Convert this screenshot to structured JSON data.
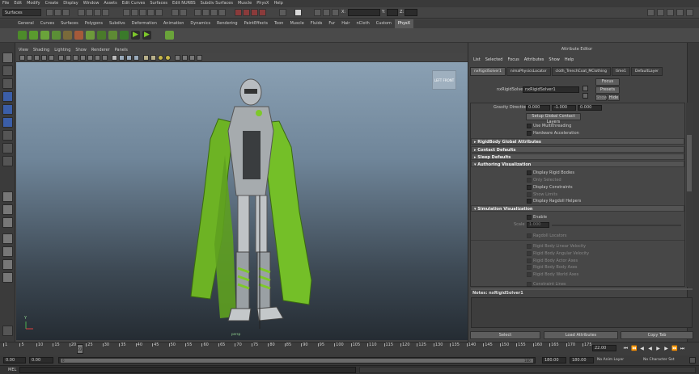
{
  "menubar": {
    "items": [
      "File",
      "Edit",
      "Modify",
      "Create",
      "Display",
      "Window",
      "Assets",
      "Edit Curves",
      "Surfaces",
      "Edit NURBS",
      "Subdiv Surfaces",
      "Muscle",
      "PhysX",
      "Help"
    ]
  },
  "statusline": {
    "menu_set": "Surfaces",
    "field_x_label": "X:",
    "field_y_label": "Y:",
    "field_z_label": "Z:"
  },
  "shelf_tabs": {
    "items": [
      "General",
      "Curves",
      "Surfaces",
      "Polygons",
      "Subdivs",
      "Deformation",
      "Animation",
      "Dynamics",
      "Rendering",
      "PaintEffects",
      "Toon",
      "Muscle",
      "Fluids",
      "Fur",
      "Hair",
      "nCloth",
      "Custom",
      "PhysX"
    ],
    "active": "PhysX"
  },
  "viewport": {
    "menu": [
      "View",
      "Shading",
      "Lighting",
      "Show",
      "Renderer",
      "Panels"
    ],
    "viewcube": {
      "left": "LEFT",
      "front": "FRONT"
    },
    "camera_label": "persp",
    "axis_y": "Y",
    "axis_x": "X"
  },
  "attribute_editor": {
    "title": "Attribute Editor",
    "menu": [
      "List",
      "Selected",
      "Focus",
      "Attributes",
      "Show",
      "Help"
    ],
    "tabs": [
      "nxRigidSolver1",
      "nimaPhysicsLocator",
      "cloth_TrenchCoat_MClothing",
      "time1",
      "DefaultLayer"
    ],
    "active_tab": "nxRigidSolver1",
    "node_label": "nxRigidSolver:",
    "node_value": "nxRigidSolver1",
    "focus_btn": "Focus",
    "presets_btn": "Presets",
    "show_btn": "Show",
    "hide_btn": "Hide",
    "gravity_label": "Gravity Direction",
    "gravity_values": [
      "0.000",
      "-1.000",
      "0.000"
    ],
    "setup_btn": "Setup Global Contact Layers",
    "use_multithreading": "Use Multithreading",
    "hardware_acceleration": "Hardware Acceleration",
    "sections": {
      "global": "RigidBody Global Attributes",
      "contact": "Contact Defaults",
      "sleep": "Sleep Defaults",
      "authoring": "Authoring Visualization",
      "simulation": "Simulation Visualization"
    },
    "authoring_items": [
      "Display Rigid Bodies",
      "Only Selected",
      "Display Constraints",
      "Show Limits",
      "Display Ragdoll Helpers"
    ],
    "enable_label": "Enable",
    "scale_label": "Scale",
    "scale_value": "1.000",
    "sim_items": [
      "Ragdoll Locators",
      "Rigid Body Linear Velocity",
      "Rigid Body Angular Velocity",
      "Rigid Body Actor Axes",
      "Rigid Body Body Axes",
      "Rigid Body World Axes",
      "Constraint Lines"
    ],
    "notes_label": "Notes: nxRigidSolver1",
    "bottom_buttons": [
      "Select",
      "Load Attributes",
      "Copy Tab"
    ]
  },
  "timeslider": {
    "ticks": [
      "1",
      "5",
      "10",
      "15",
      "20",
      "25",
      "30",
      "35",
      "40",
      "45",
      "50",
      "55",
      "60",
      "65",
      "70",
      "75",
      "80",
      "85",
      "90",
      "95",
      "100",
      "105",
      "110",
      "115",
      "120",
      "125",
      "130",
      "135",
      "140",
      "145",
      "150",
      "155",
      "160",
      "165",
      "170",
      "175"
    ],
    "current_frame": "22",
    "current_time_field": "22.00"
  },
  "rangeslider": {
    "start_time": "0.00",
    "playback_start": "0.00",
    "range_start_marker": "0",
    "range_end_marker": "180",
    "playback_end": "180.00",
    "end_time": "180.00",
    "anim_layer": "No Anim Layer",
    "char_set": "No Character Set"
  },
  "cmdline": {
    "label": "MEL"
  },
  "colors": {
    "accent_green": "#7ec82a",
    "panel_bg": "#444444",
    "viewport_top": "#8aa0b3",
    "viewport_bottom": "#252c33"
  }
}
